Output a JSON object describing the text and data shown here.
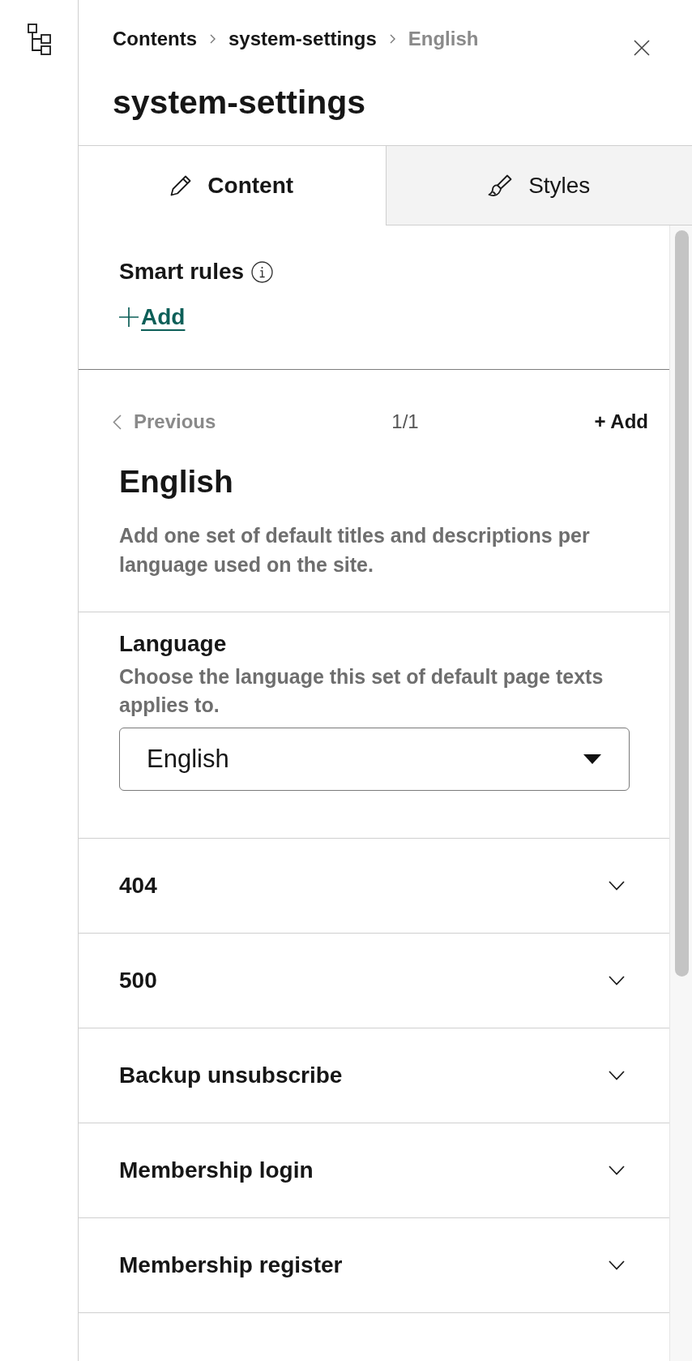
{
  "breadcrumb": [
    {
      "label": "Contents",
      "current": false
    },
    {
      "label": "system-settings",
      "current": false
    },
    {
      "label": "English",
      "current": true
    }
  ],
  "title": "system-settings",
  "tabs": [
    {
      "label": "Content",
      "selected": true
    },
    {
      "label": "Styles",
      "selected": false
    }
  ],
  "smart_rules": {
    "label": "Smart rules",
    "add_link": "Add"
  },
  "pager": {
    "previous": {
      "label": "Previous",
      "disabled": true
    },
    "position": "1/1",
    "add_button": "+ Add"
  },
  "entry": {
    "title": "English",
    "description": "Add one set of default titles and descriptions per language used on the site."
  },
  "language": {
    "label": "Language",
    "help": "Choose the language this set of default page texts applies to.",
    "value": "English"
  },
  "sections": [
    {
      "label": "404",
      "expanded": false
    },
    {
      "label": "500",
      "expanded": false
    },
    {
      "label": "Backup unsubscribe",
      "expanded": false
    },
    {
      "label": "Membership login",
      "expanded": false
    },
    {
      "label": "Membership register",
      "expanded": false
    }
  ]
}
